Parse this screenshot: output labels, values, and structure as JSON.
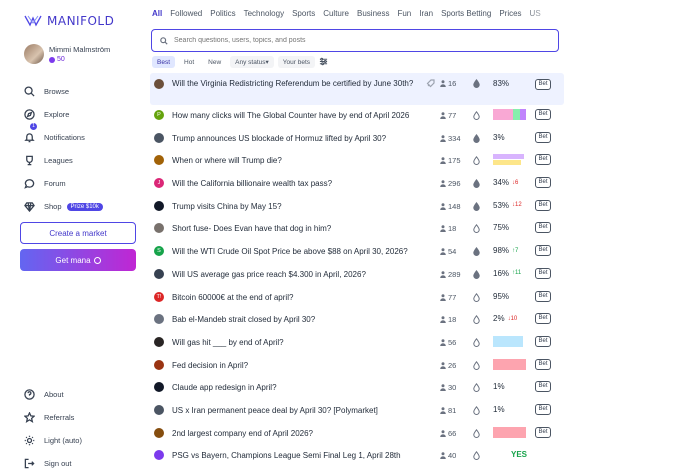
{
  "app": {
    "logo_text": "MANIFOLD",
    "accent": "#4f46e5"
  },
  "user": {
    "name": "Mimmi Malmström",
    "balance": "50"
  },
  "nav": {
    "browse": "Browse",
    "explore": "Explore",
    "notifications": "Notifications",
    "notifications_count": "1",
    "leagues": "Leagues",
    "forum": "Forum",
    "shop": "Shop",
    "shop_badge": "Prize $10k"
  },
  "actions": {
    "create_market": "Create a market",
    "get_mana": "Get mana"
  },
  "bottom_nav": {
    "about": "About",
    "referrals": "Referrals",
    "theme": "Light (auto)",
    "sign_out": "Sign out"
  },
  "topics": [
    "All",
    "Followed",
    "Politics",
    "Technology",
    "Sports",
    "Culture",
    "Business",
    "Fun",
    "Iran",
    "Sports Betting",
    "Prices",
    "US"
  ],
  "search": {
    "placeholder": "Search questions, users, topics, and posts"
  },
  "filters": {
    "best": "Best",
    "hot": "Hot",
    "new": "New",
    "status": "Any status",
    "your_bets": "Your bets"
  },
  "bet_label": "Bet",
  "markets": [
    {
      "title": "Will the Virginia Redistricting Referendum be certified by June 30th?",
      "traders": "16",
      "prob": "83%",
      "delta": "",
      "dir": "",
      "avatar_color": "#6b4f3a",
      "avatar_text": "",
      "drop": "filled"
    },
    {
      "title": "How many clicks will The Global Counter have by end of April 2026",
      "traders": "77",
      "prob": "",
      "delta": "",
      "dir": "",
      "avatar_color": "#65a30d",
      "avatar_text": "P",
      "drop": "outline",
      "bar": [
        {
          "c": "#f9a8d4",
          "w": 0.62
        },
        {
          "c": "#86efac",
          "w": 0.2
        },
        {
          "c": "#c084fc",
          "w": 0.18
        }
      ]
    },
    {
      "title": "Trump announces US blockade of Hormuz lifted by April 30?",
      "traders": "334",
      "prob": "3%",
      "delta": "",
      "dir": "",
      "avatar_color": "#4b5563",
      "avatar_text": "",
      "drop": "filled"
    },
    {
      "title": "When or where will Trump die?",
      "traders": "175",
      "prob": "",
      "delta": "",
      "dir": "",
      "avatar_color": "#a16207",
      "avatar_text": "",
      "drop": "outline",
      "bar2": [
        {
          "c": "#d8b4fe",
          "w": 0.95
        },
        {
          "c": "#fde68a",
          "w": 0.85
        }
      ]
    },
    {
      "title": "Will the California billionaire wealth tax pass?",
      "traders": "296",
      "prob": "34%",
      "delta": "6",
      "dir": "down",
      "avatar_color": "#db2777",
      "avatar_text": "J",
      "drop": "filled"
    },
    {
      "title": "Trump visits China by May 15?",
      "traders": "148",
      "prob": "53%",
      "delta": "12",
      "dir": "down",
      "avatar_color": "#111827",
      "avatar_text": "",
      "drop": "filled"
    },
    {
      "title": "Short fuse- Does Evan have that dog in him?",
      "traders": "18",
      "prob": "75%",
      "delta": "",
      "dir": "",
      "avatar_color": "#78716c",
      "avatar_text": "",
      "drop": "outline"
    },
    {
      "title": "Will the WTI Crude Oil Spot Price be above $88 on April 30, 2026?",
      "traders": "54",
      "prob": "98%",
      "delta": "7",
      "dir": "up",
      "avatar_color": "#16a34a",
      "avatar_text": "S",
      "drop": "filled"
    },
    {
      "title": "Will US average gas price reach $4.300 in April, 2026?",
      "traders": "289",
      "prob": "16%",
      "delta": "11",
      "dir": "up",
      "avatar_color": "#374151",
      "avatar_text": "",
      "drop": "filled"
    },
    {
      "title": "Bitcoin 60000€ at the end of april?",
      "traders": "77",
      "prob": "95%",
      "delta": "",
      "dir": "",
      "avatar_color": "#dc2626",
      "avatar_text": "T!",
      "drop": "outline"
    },
    {
      "title": "Bab el-Mandeb strait closed by April 30?",
      "traders": "18",
      "prob": "2%",
      "delta": "10",
      "dir": "down",
      "avatar_color": "#6b7280",
      "avatar_text": "",
      "drop": "outline"
    },
    {
      "title": "Will gas hit ___ by end of April?",
      "traders": "56",
      "prob": "",
      "delta": "",
      "dir": "",
      "avatar_color": "#292524",
      "avatar_text": "",
      "drop": "outline",
      "bar": [
        {
          "c": "#bae6fd",
          "w": 0.9
        }
      ]
    },
    {
      "title": "Fed decision in April?",
      "traders": "26",
      "prob": "",
      "delta": "",
      "dir": "",
      "avatar_color": "#9a3412",
      "avatar_text": "",
      "drop": "outline",
      "bar": [
        {
          "c": "#fda4af",
          "w": 1.0
        }
      ]
    },
    {
      "title": "Claude app redesign in April?",
      "traders": "30",
      "prob": "1%",
      "delta": "",
      "dir": "",
      "avatar_color": "#111827",
      "avatar_text": "",
      "drop": "outline"
    },
    {
      "title": "US x Iran permanent peace deal by April 30? [Polymarket]",
      "traders": "81",
      "prob": "1%",
      "delta": "",
      "dir": "",
      "avatar_color": "#4b5563",
      "avatar_text": "",
      "drop": "outline"
    },
    {
      "title": "2nd largest company end of April 2026?",
      "traders": "66",
      "prob": "",
      "delta": "",
      "dir": "",
      "avatar_color": "#854d0e",
      "avatar_text": "",
      "drop": "outline",
      "bar": [
        {
          "c": "#fda4af",
          "w": 1.0
        }
      ]
    },
    {
      "title": "PSG vs Bayern, Champions League Semi Final Leg 1, April 28th",
      "traders": "40",
      "prob": "YES",
      "delta": "",
      "dir": "",
      "avatar_color": "#7c3aed",
      "avatar_text": "",
      "drop": "outline",
      "resolved": true
    }
  ]
}
